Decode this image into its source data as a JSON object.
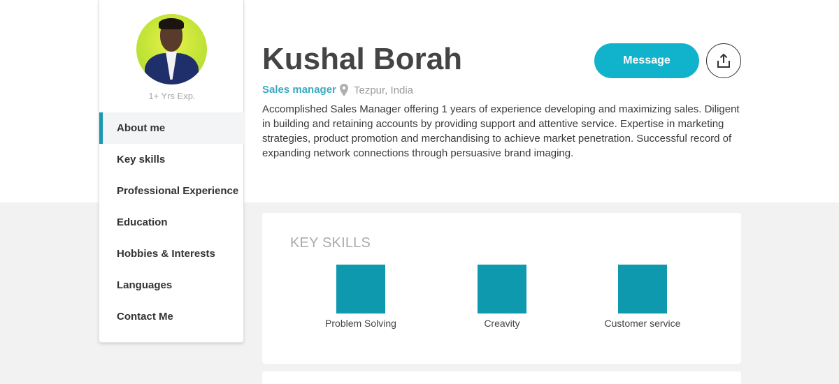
{
  "sidebar": {
    "experience": "1+ Yrs Exp.",
    "items": [
      {
        "label": "About me"
      },
      {
        "label": "Key skills"
      },
      {
        "label": "Professional Experience"
      },
      {
        "label": "Education"
      },
      {
        "label": "Hobbies & Interests"
      },
      {
        "label": "Languages"
      },
      {
        "label": "Contact Me"
      }
    ],
    "active_item": "About me",
    "accent_color": "#1799b0"
  },
  "profile": {
    "name": "Kushal Borah",
    "role": "Sales manager",
    "location": "Tezpur, India",
    "bio": "Accomplished Sales Manager offering 1 years of experience developing and maximizing sales. Diligent in building and retaining accounts by providing support and attentive service. Expertise in marketing strategies, product promotion and merchandising to achieve market penetration. Successful record of expanding network connections through persuasive brand imaging."
  },
  "actions": {
    "message_label": "Message",
    "message_color": "#11b2cc",
    "share_icon": "share-upload-icon"
  },
  "key_skills": {
    "title": "KEY SKILLS",
    "tile_color": "#0e99ae",
    "items": [
      {
        "label": "Problem Solving"
      },
      {
        "label": "Creavity"
      },
      {
        "label": "Customer service"
      }
    ]
  }
}
